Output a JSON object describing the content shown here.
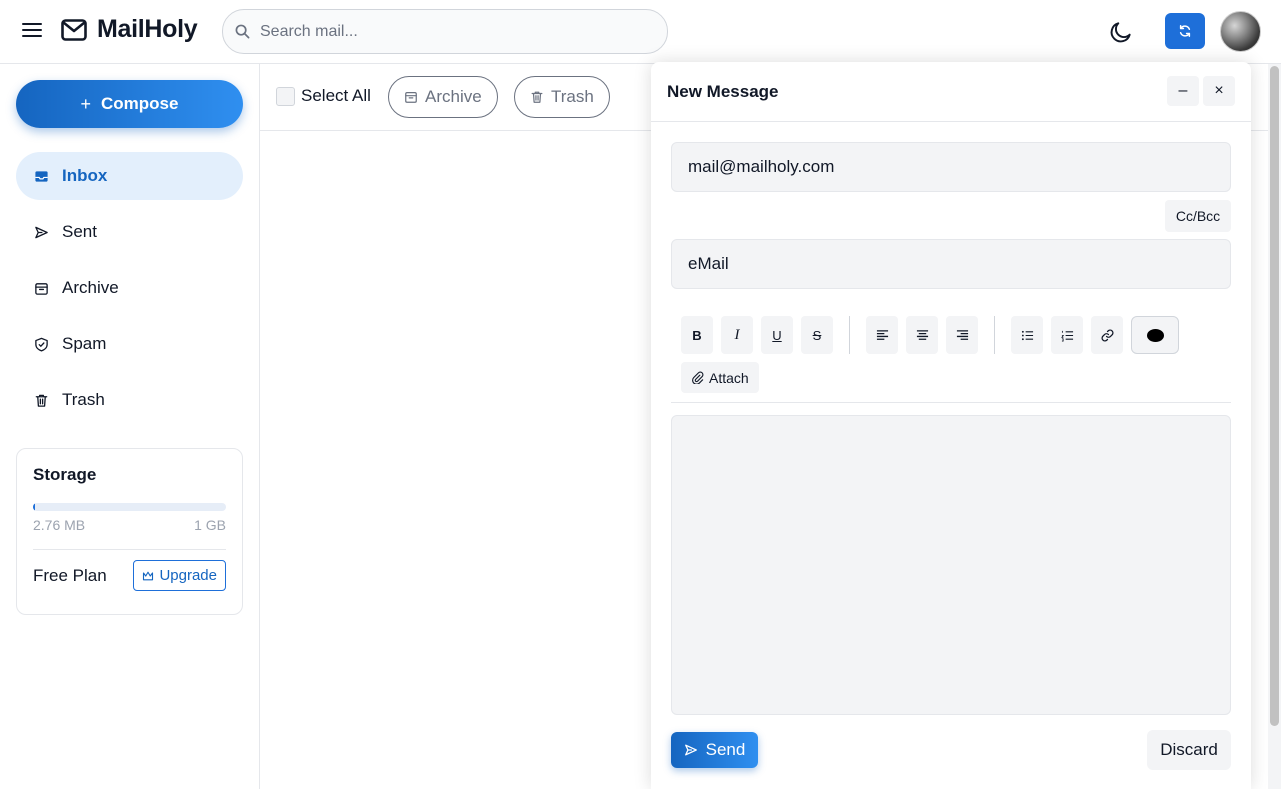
{
  "app": {
    "name": "MailHoly"
  },
  "search": {
    "placeholder": "Search mail..."
  },
  "sidebar": {
    "compose_label": "Compose",
    "items": [
      {
        "label": "Inbox",
        "icon": "inbox-icon",
        "active": true
      },
      {
        "label": "Sent",
        "icon": "send-icon",
        "active": false
      },
      {
        "label": "Archive",
        "icon": "archive-icon",
        "active": false
      },
      {
        "label": "Spam",
        "icon": "shield-icon",
        "active": false
      },
      {
        "label": "Trash",
        "icon": "trash-icon",
        "active": false
      }
    ],
    "storage": {
      "title": "Storage",
      "used": "2.76 MB",
      "total": "1 GB",
      "used_fraction": 0.0027,
      "plan": "Free Plan",
      "upgrade_label": "Upgrade"
    }
  },
  "toolbar": {
    "select_all_label": "Select All",
    "archive_label": "Archive",
    "trash_label": "Trash"
  },
  "compose_window": {
    "title": "New Message",
    "minimize_label": "–",
    "close_label": "×",
    "to_value": "mail@mailholy.com",
    "cc_bcc_label": "Cc/Bcc",
    "subject_value": "eMail",
    "format_buttons": {
      "bold": "B",
      "italic": "I",
      "underline": "U",
      "strike": "S"
    },
    "text_color": "#000000",
    "attach_label": "Attach",
    "send_label": "Send",
    "discard_label": "Discard"
  },
  "colors": {
    "accent": "#1565c0",
    "accent_light": "#2f8ff0",
    "active_bg": "#e3effc"
  }
}
